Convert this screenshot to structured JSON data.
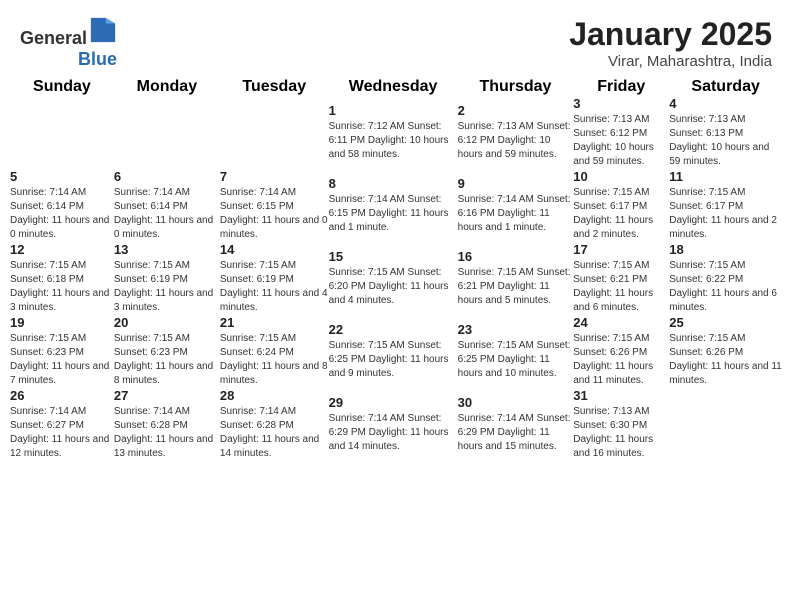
{
  "header": {
    "logo_general": "General",
    "logo_blue": "Blue",
    "month_title": "January 2025",
    "location": "Virar, Maharashtra, India"
  },
  "days_of_week": [
    "Sunday",
    "Monday",
    "Tuesday",
    "Wednesday",
    "Thursday",
    "Friday",
    "Saturday"
  ],
  "weeks": [
    [
      {
        "day": "",
        "info": ""
      },
      {
        "day": "",
        "info": ""
      },
      {
        "day": "",
        "info": ""
      },
      {
        "day": "1",
        "info": "Sunrise: 7:12 AM\nSunset: 6:11 PM\nDaylight: 10 hours\nand 58 minutes."
      },
      {
        "day": "2",
        "info": "Sunrise: 7:13 AM\nSunset: 6:12 PM\nDaylight: 10 hours\nand 59 minutes."
      },
      {
        "day": "3",
        "info": "Sunrise: 7:13 AM\nSunset: 6:12 PM\nDaylight: 10 hours\nand 59 minutes."
      },
      {
        "day": "4",
        "info": "Sunrise: 7:13 AM\nSunset: 6:13 PM\nDaylight: 10 hours\nand 59 minutes."
      }
    ],
    [
      {
        "day": "5",
        "info": "Sunrise: 7:14 AM\nSunset: 6:14 PM\nDaylight: 11 hours\nand 0 minutes."
      },
      {
        "day": "6",
        "info": "Sunrise: 7:14 AM\nSunset: 6:14 PM\nDaylight: 11 hours\nand 0 minutes."
      },
      {
        "day": "7",
        "info": "Sunrise: 7:14 AM\nSunset: 6:15 PM\nDaylight: 11 hours\nand 0 minutes."
      },
      {
        "day": "8",
        "info": "Sunrise: 7:14 AM\nSunset: 6:15 PM\nDaylight: 11 hours\nand 1 minute."
      },
      {
        "day": "9",
        "info": "Sunrise: 7:14 AM\nSunset: 6:16 PM\nDaylight: 11 hours\nand 1 minute."
      },
      {
        "day": "10",
        "info": "Sunrise: 7:15 AM\nSunset: 6:17 PM\nDaylight: 11 hours\nand 2 minutes."
      },
      {
        "day": "11",
        "info": "Sunrise: 7:15 AM\nSunset: 6:17 PM\nDaylight: 11 hours\nand 2 minutes."
      }
    ],
    [
      {
        "day": "12",
        "info": "Sunrise: 7:15 AM\nSunset: 6:18 PM\nDaylight: 11 hours\nand 3 minutes."
      },
      {
        "day": "13",
        "info": "Sunrise: 7:15 AM\nSunset: 6:19 PM\nDaylight: 11 hours\nand 3 minutes."
      },
      {
        "day": "14",
        "info": "Sunrise: 7:15 AM\nSunset: 6:19 PM\nDaylight: 11 hours\nand 4 minutes."
      },
      {
        "day": "15",
        "info": "Sunrise: 7:15 AM\nSunset: 6:20 PM\nDaylight: 11 hours\nand 4 minutes."
      },
      {
        "day": "16",
        "info": "Sunrise: 7:15 AM\nSunset: 6:21 PM\nDaylight: 11 hours\nand 5 minutes."
      },
      {
        "day": "17",
        "info": "Sunrise: 7:15 AM\nSunset: 6:21 PM\nDaylight: 11 hours\nand 6 minutes."
      },
      {
        "day": "18",
        "info": "Sunrise: 7:15 AM\nSunset: 6:22 PM\nDaylight: 11 hours\nand 6 minutes."
      }
    ],
    [
      {
        "day": "19",
        "info": "Sunrise: 7:15 AM\nSunset: 6:23 PM\nDaylight: 11 hours\nand 7 minutes."
      },
      {
        "day": "20",
        "info": "Sunrise: 7:15 AM\nSunset: 6:23 PM\nDaylight: 11 hours\nand 8 minutes."
      },
      {
        "day": "21",
        "info": "Sunrise: 7:15 AM\nSunset: 6:24 PM\nDaylight: 11 hours\nand 8 minutes."
      },
      {
        "day": "22",
        "info": "Sunrise: 7:15 AM\nSunset: 6:25 PM\nDaylight: 11 hours\nand 9 minutes."
      },
      {
        "day": "23",
        "info": "Sunrise: 7:15 AM\nSunset: 6:25 PM\nDaylight: 11 hours\nand 10 minutes."
      },
      {
        "day": "24",
        "info": "Sunrise: 7:15 AM\nSunset: 6:26 PM\nDaylight: 11 hours\nand 11 minutes."
      },
      {
        "day": "25",
        "info": "Sunrise: 7:15 AM\nSunset: 6:26 PM\nDaylight: 11 hours\nand 11 minutes."
      }
    ],
    [
      {
        "day": "26",
        "info": "Sunrise: 7:14 AM\nSunset: 6:27 PM\nDaylight: 11 hours\nand 12 minutes."
      },
      {
        "day": "27",
        "info": "Sunrise: 7:14 AM\nSunset: 6:28 PM\nDaylight: 11 hours\nand 13 minutes."
      },
      {
        "day": "28",
        "info": "Sunrise: 7:14 AM\nSunset: 6:28 PM\nDaylight: 11 hours\nand 14 minutes."
      },
      {
        "day": "29",
        "info": "Sunrise: 7:14 AM\nSunset: 6:29 PM\nDaylight: 11 hours\nand 14 minutes."
      },
      {
        "day": "30",
        "info": "Sunrise: 7:14 AM\nSunset: 6:29 PM\nDaylight: 11 hours\nand 15 minutes."
      },
      {
        "day": "31",
        "info": "Sunrise: 7:13 AM\nSunset: 6:30 PM\nDaylight: 11 hours\nand 16 minutes."
      },
      {
        "day": "",
        "info": ""
      }
    ]
  ]
}
